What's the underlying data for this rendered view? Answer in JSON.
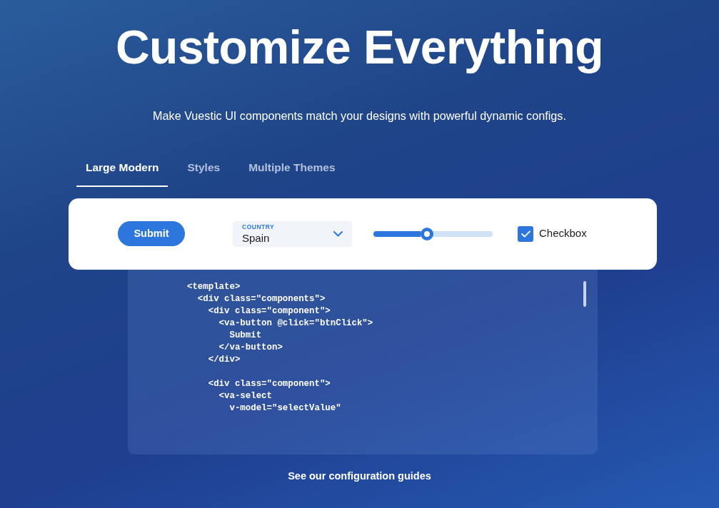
{
  "heading": "Customize Everything",
  "subtitle": "Make Vuestic UI components match your designs with powerful dynamic configs.",
  "tabs": [
    {
      "label": "Large Modern",
      "selected": true
    },
    {
      "label": "Styles",
      "selected": false
    },
    {
      "label": "Multiple Themes",
      "selected": false
    }
  ],
  "demo": {
    "button": "Submit",
    "select": {
      "label": "COUNTRY",
      "value": "Spain"
    },
    "slider": {
      "level": 0.45
    },
    "checkbox": {
      "label": "Checkbox",
      "checked": true
    }
  },
  "code": "<template>\n  <div class=\"components\">\n    <div class=\"component\">\n      <va-button @click=\"btnClick\">\n        Submit\n      </va-button>\n    </div>\n\n    <div class=\"component\">\n      <va-select\n        v-model=\"selectValue\"",
  "link": "See our configuration guides"
}
